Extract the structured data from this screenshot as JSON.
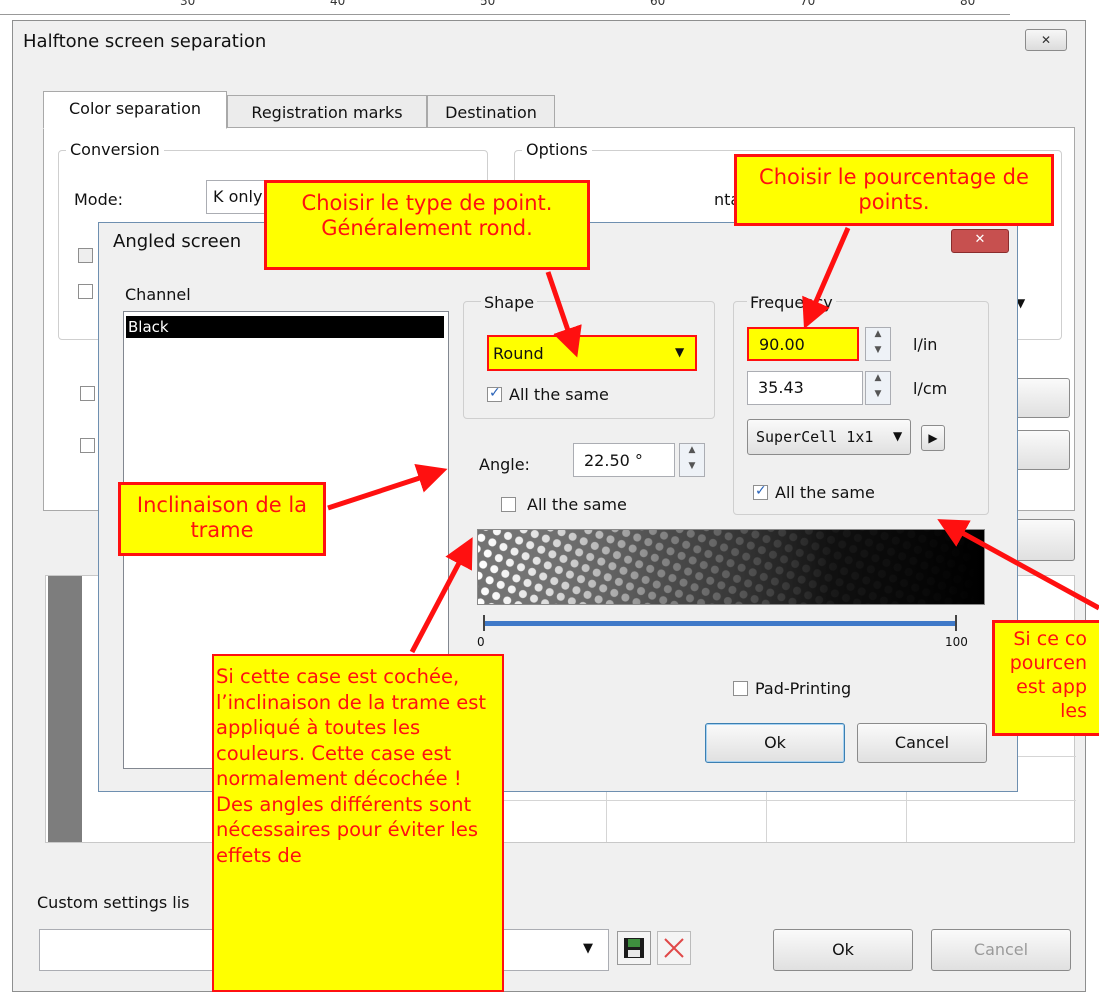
{
  "ruler": {
    "ticks": [
      "30",
      "40",
      "50",
      "60",
      "70",
      "80"
    ]
  },
  "outer_dialog": {
    "title": "Halftone screen separation",
    "close_glyph": "✕",
    "tabs": [
      "Color separation",
      "Registration marks",
      "Destination"
    ],
    "conversion_label": "Conversion",
    "mode_label": "Mode:",
    "mode_value": "K only",
    "options_label": "Options",
    "options_text": "ntain document",
    "custom_settings_label": "Custom settings lis",
    "ok_label": "Ok",
    "cancel_label": "Cancel"
  },
  "inner_dialog": {
    "title": "Angled screen",
    "close_glyph": "✕",
    "channel_label": "Channel",
    "channels": [
      "Black"
    ],
    "shape_label": "Shape",
    "shape_value": "Round",
    "shape_all_same": "All the same",
    "angle_label": "Angle:",
    "angle_value": "22.50 °",
    "angle_all_same": "All the same",
    "frequency_label": "Frequency",
    "freq_lin_value": "90.00",
    "freq_lin_unit": "l/in",
    "freq_lcm_value": "35.43",
    "freq_lcm_unit": "l/cm",
    "supercell_value": "SuperCell 1x1",
    "freq_all_same": "All the same",
    "slider_min": "0",
    "slider_max": "100",
    "pad_printing": "Pad-Printing",
    "ok_label": "Ok",
    "cancel_label": "Cancel"
  },
  "callouts": {
    "shape": "Choisir le type de point. Généralement rond.",
    "frequency": "Choisir le pourcentage de points.",
    "angle": "Inclinaison de la trame",
    "angle_note": "Si cette case est cochée, l’inclinaison de la trame est appliqué à toutes les couleurs. Cette case est normalement décochée ! Des angles différents sont nécessaires pour éviter les effets de",
    "freq_note": "Si ce co pourcen est app les"
  },
  "colors": {
    "callout_fill": "#ffff00",
    "callout_border": "#ff1010",
    "arrow": "#ff1010",
    "selection": "#000000"
  }
}
